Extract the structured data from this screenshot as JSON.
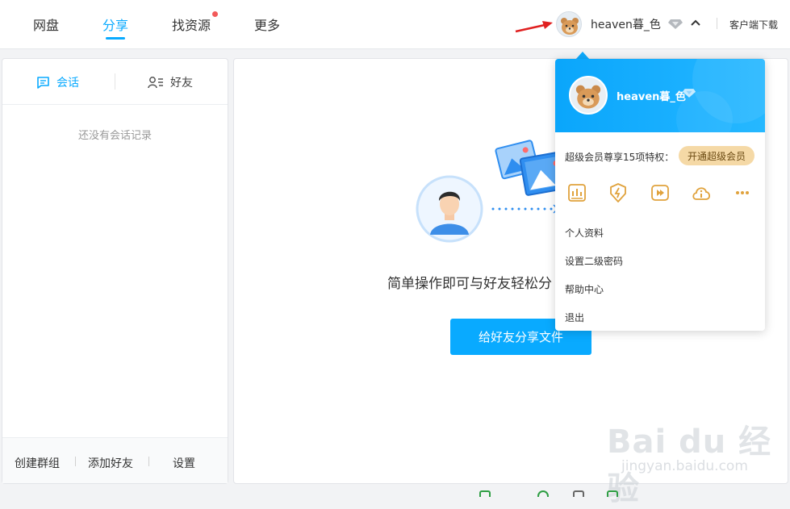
{
  "nav": {
    "tabs": [
      "网盘",
      "分享",
      "找资源",
      "更多"
    ],
    "active": "分享"
  },
  "user": {
    "name": "heaven暮_色"
  },
  "topbar": {
    "client_download": "客户端下载"
  },
  "left_panel": {
    "tab_sessions": "会话",
    "tab_friends": "好友",
    "empty_text": "还没有会话记录",
    "footer": {
      "create_group": "创建群组",
      "add_friend": "添加好友",
      "settings": "设置"
    }
  },
  "main": {
    "description": "简单操作即可与好友轻松分",
    "share_button": "给好友分享文件"
  },
  "dropdown": {
    "vip_text": "超级会员尊享15项特权：",
    "vip_button": "开通超级会员",
    "privilege_icons": [
      "speed-chart-icon",
      "fast-download-icon",
      "video-speed-icon",
      "cloud-info-icon",
      "more-dots-icon"
    ],
    "menu": [
      "个人资料",
      "设置二级密码",
      "帮助中心",
      "退出"
    ]
  },
  "watermark": {
    "logo": "Bai du 经验",
    "url": "jingyan.baidu.com"
  },
  "colors": {
    "accent": "#09aaff",
    "vip_gold": "#f5d9a6",
    "badge_red": "#f25a5a"
  }
}
